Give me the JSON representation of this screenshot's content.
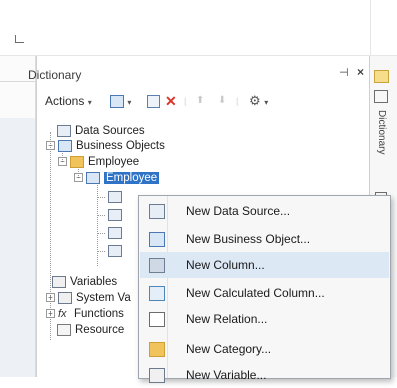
{
  "panel": {
    "title": "Dictionary",
    "pin_glyph": "⊣",
    "close_glyph": "×"
  },
  "toolbar": {
    "actions_label": "Actions",
    "caret": "▾",
    "delete_glyph": "✕",
    "up_glyph": "⬆",
    "down_glyph": "⬇",
    "settings_glyph": "⚙"
  },
  "tree": {
    "data_sources": "Data Sources",
    "business_objects": "Business Objects",
    "employee_folder": "Employee",
    "employee_object": "Employee",
    "variables": "Variables",
    "system_variables": "System Va",
    "functions": "Functions",
    "resources": "Resource",
    "expander_minus": "−",
    "expander_plus": "+",
    "fx_glyph": "fx"
  },
  "right_strip": {
    "label": "Dictionary"
  },
  "context_menu": {
    "items": [
      {
        "label": "New Data Source...",
        "icon": "data-source-icon"
      },
      {
        "label": "New Business Object...",
        "icon": "business-object-icon"
      },
      {
        "label": "New Column...",
        "icon": "column-icon"
      },
      {
        "label": "New Calculated Column...",
        "icon": "calculated-column-icon"
      },
      {
        "label": "New Relation...",
        "icon": "relation-icon"
      },
      {
        "label": "New Category...",
        "icon": "category-icon"
      },
      {
        "label": "New Variable...",
        "icon": "variable-icon"
      }
    ],
    "highlighted_index": 2
  },
  "colors": {
    "selection": "#2f73c6",
    "menu_highlight": "#dde8f5",
    "delete_red": "#d9352b"
  }
}
